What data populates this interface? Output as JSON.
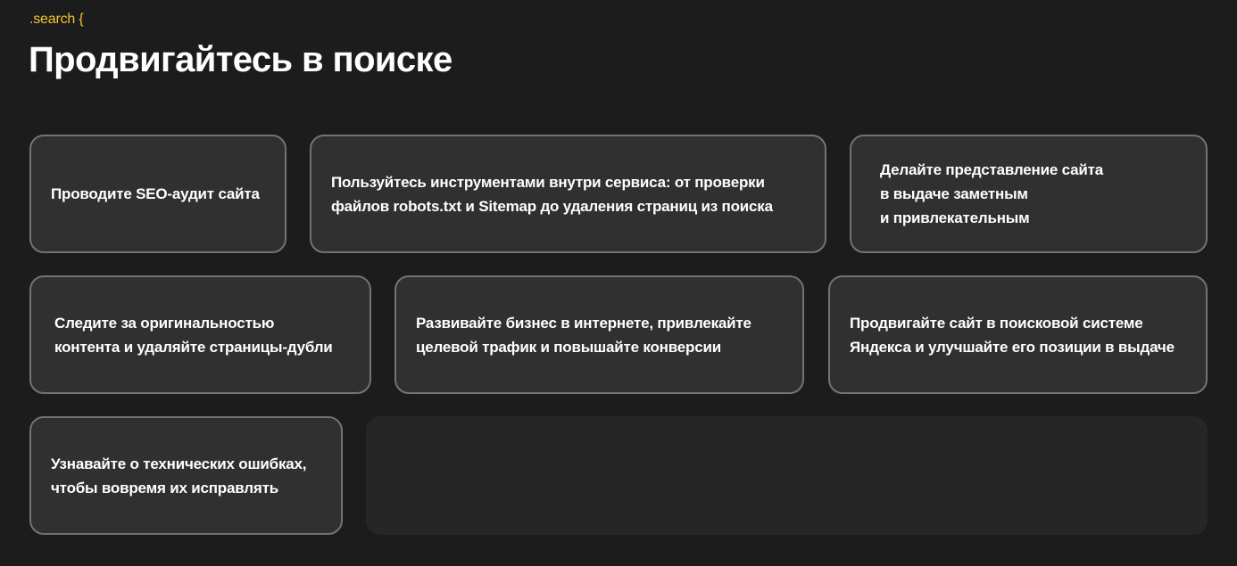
{
  "header": {
    "code_tag": ".search {",
    "title": "Продвигайтесь в поиске"
  },
  "cards": [
    {
      "text": "Проводите SEO-аудит сайта"
    },
    {
      "text": "Пользуйтесь инструментами внутри сервиса: от проверки\nфайлов robots.txt и Sitemap до удаления страниц из поиска"
    },
    {
      "text": "Делайте представление сайта\nв выдаче заметным\nи привлекательным"
    },
    {
      "text": "Следите за оригинальностью\nконтента и удаляйте страницы-дубли"
    },
    {
      "text": "Развивайте бизнес в интернете, привлекайте\nцелевой трафик и повышайте конверсии"
    },
    {
      "text": "Продвигайте сайт в поисковой системе\nЯндекса и улучшайте его позиции в выдаче"
    },
    {
      "text": "Узнавайте о технических ошибках,\nчтобы вовремя их исправлять"
    }
  ],
  "colors": {
    "background": "#1c1c1c",
    "card_background": "#303030",
    "card_border": "#737373",
    "accent": "#f7c52b",
    "panel_background": "#262626"
  }
}
